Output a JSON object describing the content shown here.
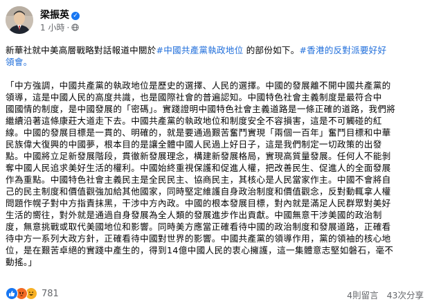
{
  "post": {
    "author": "梁振英",
    "timestamp": "1 小時",
    "dot": "·",
    "audience_icon": "globe-icon",
    "verified_icon": "verified-badge-icon",
    "intro_prefix": "新華社就中美高層戰略對話報道中關於",
    "intro_hashtag1": "#中國共產黨執政地位",
    "intro_middle": " 的部份如下。",
    "intro_hashtag2": "#香港的反對派要好好",
    "intro_line2": "領會。",
    "quote_lines": [
      "「中方強調，中國共產黨的執政地位是歷史的選擇、人民的選擇。中國的發展離不開中國共產黨的",
      "領導，這是中國人民的高度共識，也是國際社會的普遍認知。中國特色社會主義制度是最符合中",
      "國國情的制度，是中國發展的「密碼」。實踐證明中國特色社會主義道路是一條正確的道路，我們將",
      "繼續沿著這條康莊大道走下去。中國共產黨的執政地位和制度安全不容損害，這是不可觸碰的紅",
      "線。中國的發展目標是一貫的、明確的，就是要通過艱苦奮鬥實現「兩個一百年」奮鬥目標和中華",
      "民族偉大復興的中國夢，根本目的是讓全體中國人民過上好日子，這是我們制定一切政策的出發",
      "點。中國將立足新發展階段，貫徹新發展理念，構建新發展格局，實現高質量發展。任何人不能剝",
      "奪中國人民追求美好生活的權利。中國始終重視保護和促進人權，把改善民生、促進人的全面發展",
      "作為重點。中國特色社會主義民主是全民民主、協商民主，其核心是人民當家作主。中國不會將自",
      "己的民主制度和價值觀強加給其他國家，同時堅定維護自身政治制度和價值觀念，反對動輒拿人權",
      "問題作幌子對中方指責抹黑，干涉中方內政。中國的根本發展目標，對內就是滿足人民群眾對美好",
      "生活的嚮往，對外就是通過自身發展為全人類的發展進步作出貢獻。中國無意干涉美國的政治制",
      "度，無意挑戰或取代美國地位和影響。同時美方應當正確看待中國的政治制度和發展道路，正確看",
      "待中方一系列大政方針，正確看待中國對世界的影響。中國共產黨的領導作用，黨的領袖的核心地",
      "位，是在艱苦卓絕的實踐中產生的，得到14億中國人民的衷心擁護，這一集體意志堅如磐石，毫不",
      "動搖。」"
    ]
  },
  "footer": {
    "reaction_icons": [
      "like-icon",
      "angry-icon",
      "haha-icon"
    ],
    "reaction_count": "781",
    "shares": "4則留言",
    "comments": "43次分享"
  },
  "colors": {
    "hashtag": "#216fdb",
    "meta": "#65676b",
    "like": "#1877f2",
    "angry": "#f26a24",
    "haha": "#f7b125"
  }
}
